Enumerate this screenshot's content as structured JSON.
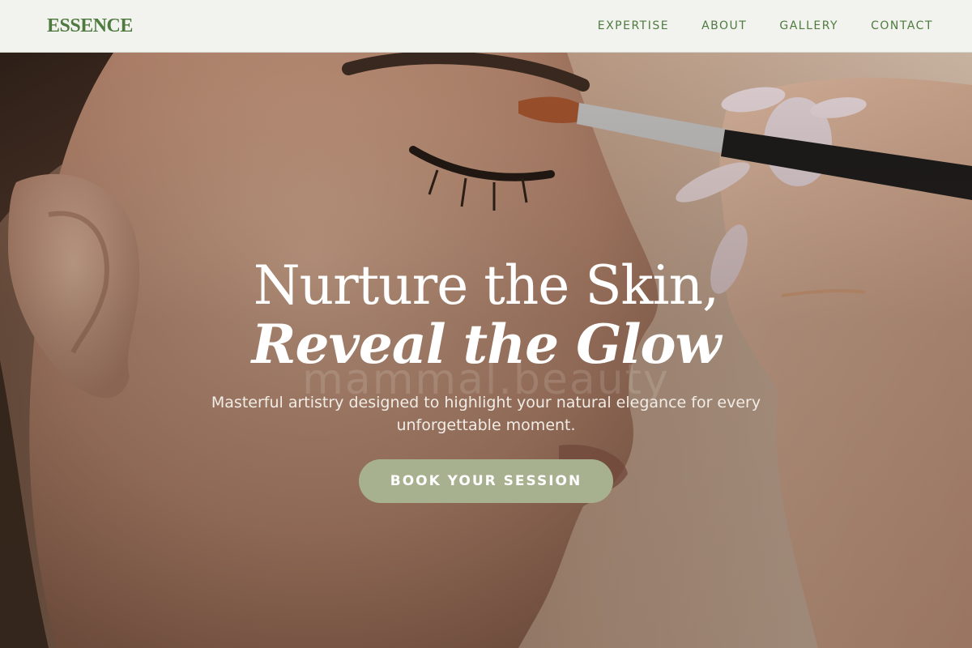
{
  "brand": {
    "logo_text": "ESSENCE"
  },
  "nav": {
    "items": [
      {
        "label": "EXPERTISE"
      },
      {
        "label": "ABOUT"
      },
      {
        "label": "GALLERY"
      },
      {
        "label": "CONTACT"
      }
    ]
  },
  "hero": {
    "headline_line1": "Nurture the Skin,",
    "headline_line2": "Reveal the Glow",
    "watermark": "mammal.beauty",
    "subtitle": "Masterful artistry designed to highlight your natural elegance for every unforgettable moment.",
    "cta_label": "BOOK YOUR SESSION"
  },
  "colors": {
    "brand_green": "#4e7a3f",
    "header_bg": "#f2f3ee",
    "cta_bg": "#a7b18f",
    "text_light": "#ffffff"
  }
}
